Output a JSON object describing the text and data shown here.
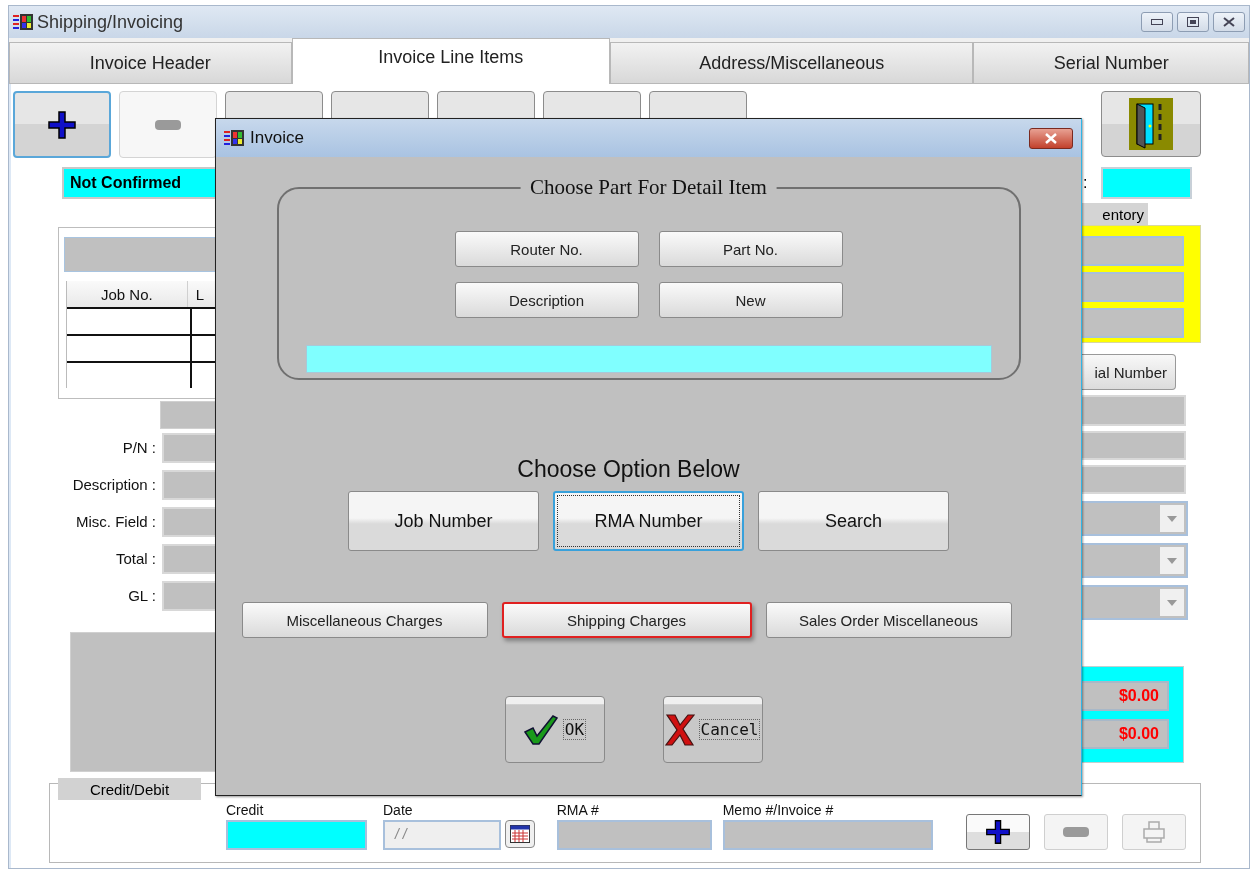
{
  "window": {
    "title": "Shipping/Invoicing"
  },
  "tabs": [
    {
      "label": "Invoice Header",
      "selected": false
    },
    {
      "label": "Invoice Line Items",
      "selected": true
    },
    {
      "label": "Address/Miscellaneous",
      "selected": false
    },
    {
      "label": "Serial Number",
      "selected": false
    }
  ],
  "toolbar": [
    {
      "kind": "add",
      "disabled": false,
      "focused": true
    },
    {
      "kind": "remove",
      "disabled": true,
      "focused": false
    },
    {
      "kind": "covered",
      "disabled": false,
      "focused": false
    },
    {
      "kind": "covered",
      "disabled": false,
      "focused": false
    },
    {
      "kind": "covered",
      "disabled": false,
      "focused": false
    },
    {
      "kind": "covered",
      "disabled": false,
      "focused": false
    },
    {
      "kind": "covered",
      "disabled": false,
      "focused": false
    }
  ],
  "status": "Not Confirmed",
  "line_table": {
    "columns": [
      "Job No.",
      "L"
    ]
  },
  "fields": [
    {
      "label": "P/N :"
    },
    {
      "label": "Description :"
    },
    {
      "label": "Misc. Field :"
    },
    {
      "label": "Total :"
    },
    {
      "label": "GL  :"
    }
  ],
  "right_panel": {
    "label": ":",
    "tab_label": "entory",
    "serial_button": "ial Number",
    "totals": [
      "$0.00",
      "$0.00"
    ]
  },
  "credit_debit": {
    "title": "Credit/Debit",
    "labels": [
      "Credit",
      "Date",
      "RMA #",
      "Memo #/Invoice #"
    ],
    "date_value": "/ /",
    "buttons": [
      {
        "kind": "add",
        "disabled": false
      },
      {
        "kind": "remove",
        "disabled": true
      },
      {
        "kind": "print",
        "disabled": true
      }
    ]
  },
  "dialog": {
    "title": "Invoice",
    "part_group": {
      "title": "Choose Part For Detail Item",
      "buttons": [
        "Router No.",
        "Part No.",
        "Description",
        "New"
      ]
    },
    "option_heading": "Choose Option Below",
    "options": [
      {
        "label": "Job Number",
        "focused": false
      },
      {
        "label": "RMA Number",
        "focused": true
      },
      {
        "label": "Search",
        "focused": false
      }
    ],
    "charges": [
      {
        "label": "Miscellaneous Charges",
        "highlighted": false
      },
      {
        "label": "Shipping Charges",
        "highlighted": true
      },
      {
        "label": "Sales Order Miscellaneous",
        "highlighted": false
      }
    ],
    "ok": "OK",
    "cancel": "Cancel"
  }
}
